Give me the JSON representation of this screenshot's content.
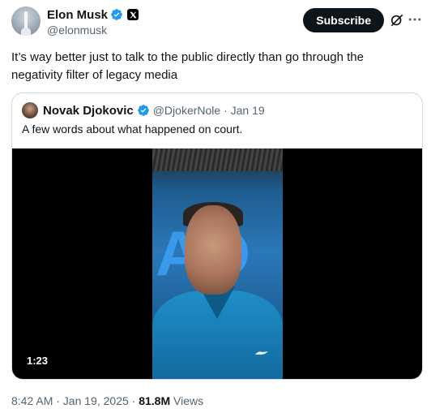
{
  "author": {
    "name": "Elon Musk",
    "handle": "@elonmusk"
  },
  "actions": {
    "subscribe_label": "Subscribe"
  },
  "tweet": {
    "text": "It’s way better just to talk to the public directly than go through the negativity filter of legacy media"
  },
  "quote": {
    "name": "Novak Djokovic",
    "handle_date": "@DjokerNole · Jan 19",
    "text": "A few words about what happened on court.",
    "video_duration": "1:23"
  },
  "meta": {
    "time_date": "8:42 AM · Jan 19, 2025 · ",
    "views_count": "81.8M",
    "views_label": " Views"
  },
  "colors": {
    "verified": "#1d9bf0",
    "text_primary": "#0f1419",
    "text_secondary": "#536471"
  },
  "icons": [
    "verified-icon",
    "x-badge-icon",
    "grok-icon",
    "more-icon"
  ]
}
